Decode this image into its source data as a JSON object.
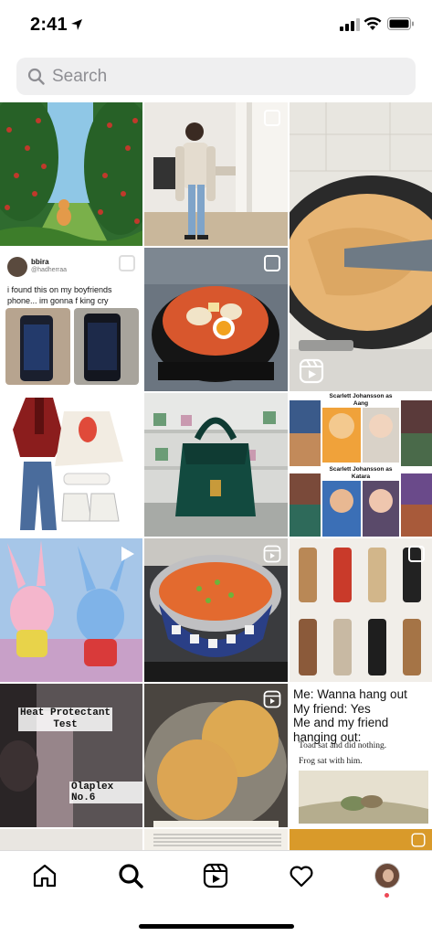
{
  "status_bar": {
    "time": "2:41"
  },
  "search": {
    "placeholder": "Search"
  },
  "grid": {
    "tweet": {
      "name": "bbira",
      "handle": "@hadherraa",
      "text": "i found this on my boyfriends phone... im gonna f    king cry"
    },
    "heat_caption": "Heat Protectant\nTest",
    "olaplex_caption": "Olaplex No.6",
    "sj_labels": [
      "Scarlett Johansson as Aang",
      "Scarlett Johansson as Katara"
    ],
    "meme": {
      "text": "Me: Wanna hang out\nMy friend: Yes\nMe and my friend hanging out:",
      "line1": "Toad sat and did nothing.",
      "line2": "Frog sat with him."
    }
  },
  "tabbar": {
    "items": [
      "home-icon",
      "search-icon",
      "reels-icon",
      "heart-icon",
      "profile-avatar"
    ]
  },
  "colors": {
    "notification": "#ed4956",
    "search_bg": "#efeff0"
  }
}
